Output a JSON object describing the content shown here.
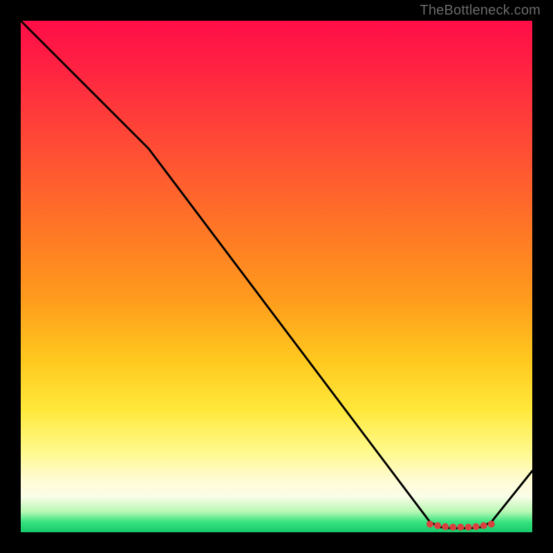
{
  "watermark": {
    "text": "TheBottleneck.com"
  },
  "chart_data": {
    "type": "line",
    "title": "",
    "xlabel": "",
    "ylabel": "",
    "xlim": [
      0,
      100
    ],
    "ylim": [
      0,
      100
    ],
    "series": [
      {
        "name": "curve",
        "x": [
          0,
          25,
          80,
          82,
          84,
          86,
          88,
          90,
          92,
          100
        ],
        "values": [
          100,
          75,
          2,
          1,
          0.8,
          0.8,
          0.8,
          1,
          2,
          12
        ]
      }
    ],
    "markers": {
      "name": "bottom-cluster",
      "x": [
        80,
        81.5,
        83,
        84.5,
        86,
        87.5,
        89,
        90.5,
        92
      ],
      "values": [
        1.6,
        1.3,
        1.1,
        1.0,
        1.0,
        1.0,
        1.1,
        1.3,
        1.6
      ],
      "color": "#d9413f",
      "radius_px": 5
    }
  }
}
